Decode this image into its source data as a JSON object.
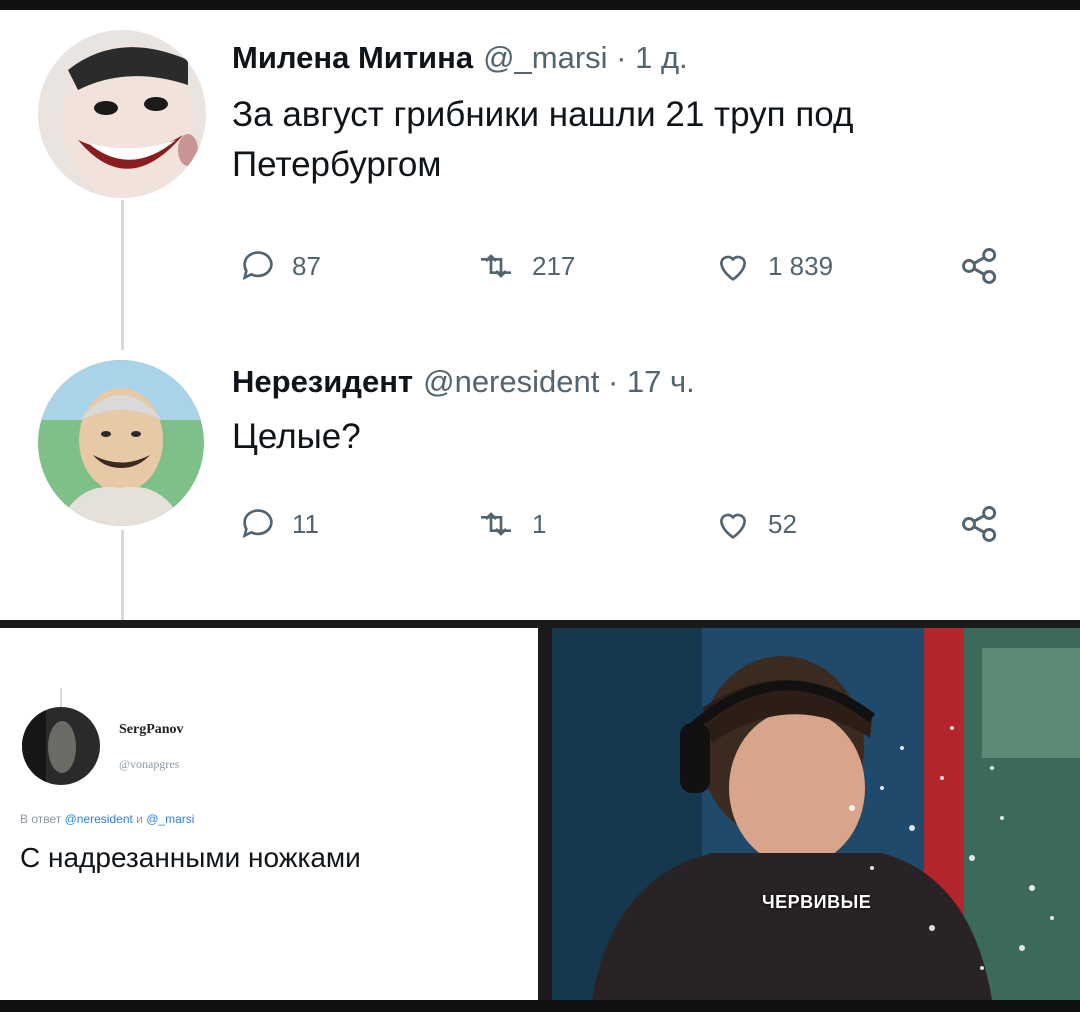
{
  "tweet1": {
    "name": "Милена Митина",
    "meta": "@_marsi · 1 д.",
    "text_line1": "За август грибники нашли 21 труп под",
    "text_line2": "Петербургом",
    "actions": {
      "replies": "87",
      "retweets": "217",
      "likes": "1 839"
    }
  },
  "tweet2": {
    "name": "Нерезидент",
    "meta": "@neresident · 17 ч.",
    "text": "Целые?",
    "actions": {
      "replies": "11",
      "retweets": "1",
      "likes": "52"
    }
  },
  "reply": {
    "name": "SergPanov",
    "handle": "@vonapgres",
    "reply_prefix": "В ответ",
    "mention1": "@neresident",
    "and": "и",
    "mention2": "@_marsi",
    "text": "С надрезанными ножками"
  },
  "meme": {
    "caption": "ЧЕРВИВЫЕ"
  },
  "colors": {
    "text": "#0f1419",
    "muted": "#536471",
    "link": "#2b7de9",
    "line": "#cfd9de"
  }
}
